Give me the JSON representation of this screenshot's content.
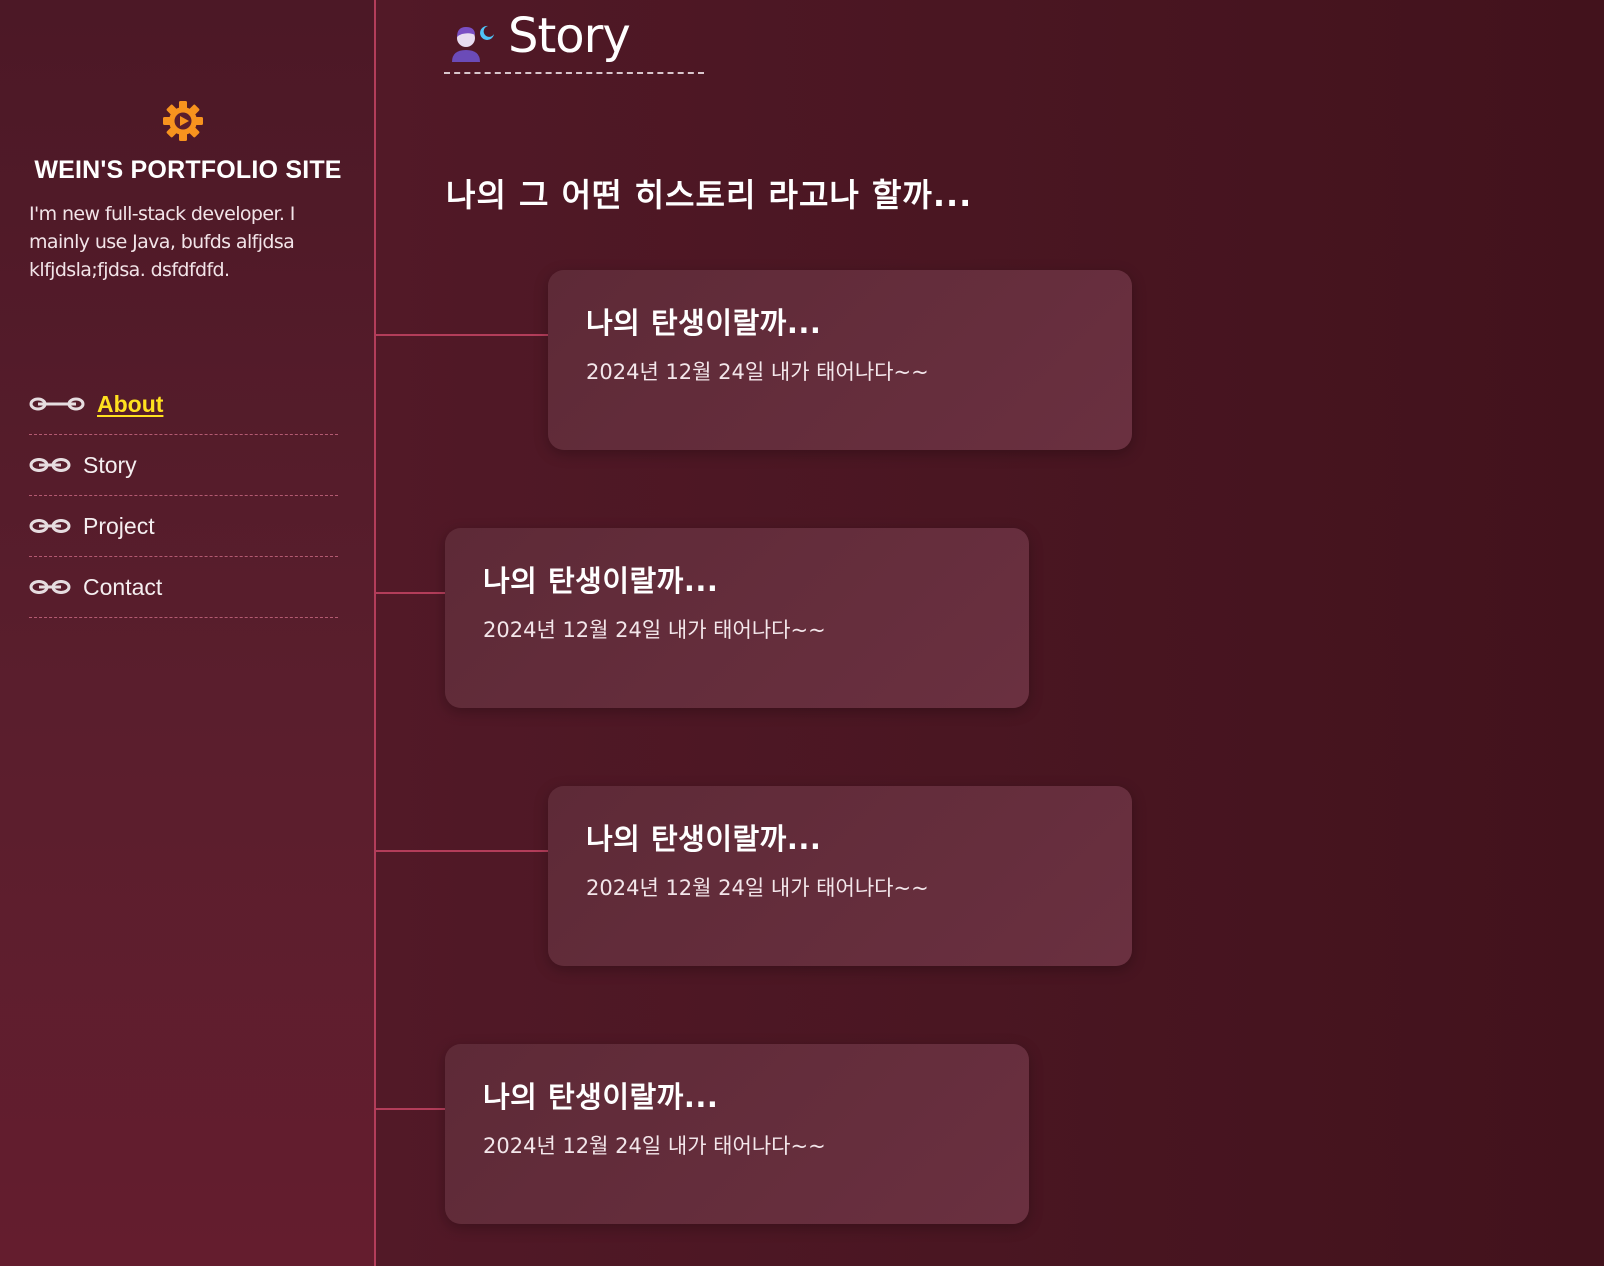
{
  "sidebar": {
    "logo_icon": "gear-play-icon",
    "title": "WEIN'S PORTFOLIO SITE",
    "description": "I'm new full-stack developer. I mainly use Java, bufds alfjdsa klfjdsla;fjdsa. dsfdfdfd.",
    "nav": [
      {
        "label": "About",
        "active": true,
        "icon": "link-icon"
      },
      {
        "label": "Story",
        "active": false,
        "icon": "link-icon"
      },
      {
        "label": "Project",
        "active": false,
        "icon": "link-icon"
      },
      {
        "label": "Contact",
        "active": false,
        "icon": "link-icon"
      }
    ]
  },
  "main": {
    "heading_icon": "person-moon-icon",
    "heading": "Story",
    "subtitle": "나의 그 어떤 히스토리 라고나 할까...",
    "timeline": [
      {
        "title": "나의 탄생이랄까...",
        "text": "2024년 12월 24일 내가 태어나다~~"
      },
      {
        "title": "나의 탄생이랄까...",
        "text": "2024년 12월 24일 내가 태어나다~~"
      },
      {
        "title": "나의 탄생이랄까...",
        "text": "2024년 12월 24일 내가 태어나다~~"
      },
      {
        "title": "나의 탄생이랄까...",
        "text": "2024년 12월 24일 내가 태어나다~~"
      }
    ]
  },
  "colors": {
    "accent": "#ffe11f",
    "logo": "#f7931e",
    "timeline_line": "#b33d5a"
  }
}
